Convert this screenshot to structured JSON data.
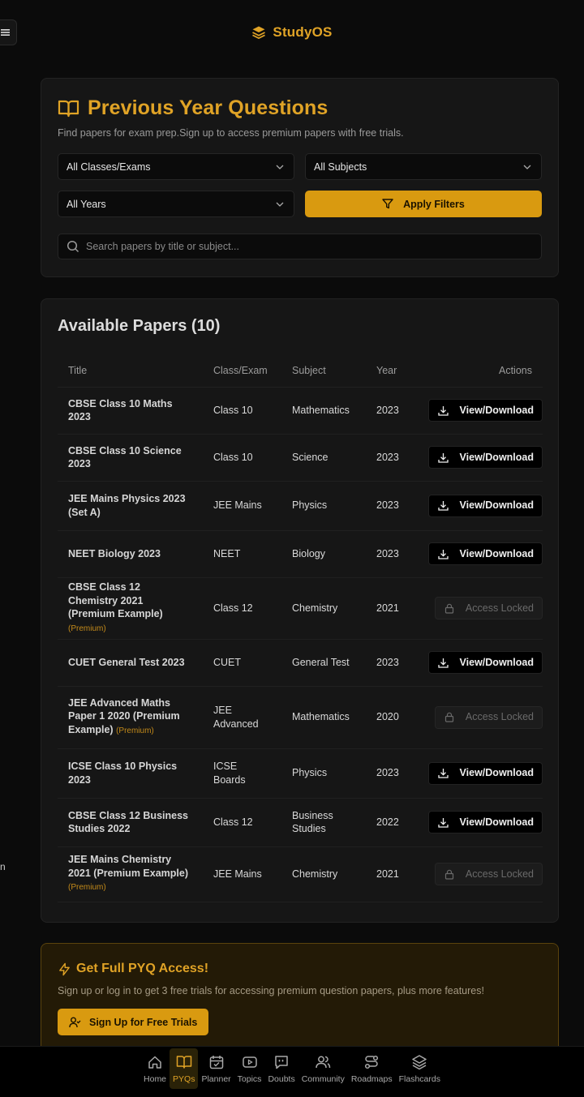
{
  "brand": {
    "name": "StudyOS"
  },
  "header": {
    "title": "Previous Year Questions",
    "subtitle": "Find papers for exam prep.Sign up to access premium papers with free trials."
  },
  "filters": {
    "class_exam": "All Classes/Exams",
    "subjects": "All Subjects",
    "years": "All Years",
    "apply_label": "Apply Filters",
    "search_placeholder": "Search papers by title or subject..."
  },
  "papers": {
    "heading": "Available Papers (10)",
    "columns": [
      "Title",
      "Class/Exam",
      "Subject",
      "Year",
      "Actions"
    ],
    "rows": [
      {
        "title": "CBSE Class 10 Maths 2023",
        "class": "Class 10",
        "subject": "Mathematics",
        "year": "2023",
        "action": "View/Download",
        "locked": false,
        "premium": ""
      },
      {
        "title": "CBSE Class 10 Science 2023",
        "class": "Class 10",
        "subject": "Science",
        "year": "2023",
        "action": "View/Download",
        "locked": false,
        "premium": ""
      },
      {
        "title": "JEE Mains Physics 2023 (Set A)",
        "class": "JEE Mains",
        "subject": "Physics",
        "year": "2023",
        "action": "View/Download",
        "locked": false,
        "premium": ""
      },
      {
        "title": "NEET Biology 2023",
        "class": "NEET",
        "subject": "Biology",
        "year": "2023",
        "action": "View/Download",
        "locked": false,
        "premium": ""
      },
      {
        "title": "CBSE Class 12 Chemistry 2021 (Premium Example)",
        "class": "Class 12",
        "subject": "Chemistry",
        "year": "2021",
        "action": "Access Locked",
        "locked": true,
        "premium": "(Premium)"
      },
      {
        "title": "CUET General Test 2023",
        "class": "CUET",
        "subject": "General Test",
        "year": "2023",
        "action": "View/Download",
        "locked": false,
        "premium": ""
      },
      {
        "title": "JEE Advanced Maths Paper 1 2020 (Premium Example)",
        "class": "JEE Advanced",
        "subject": "Mathematics",
        "year": "2020",
        "action": "Access Locked",
        "locked": true,
        "premium": "(Premium)"
      },
      {
        "title": "ICSE Class 10 Physics 2023",
        "class": "ICSE Boards",
        "subject": "Physics",
        "year": "2023",
        "action": "View/Download",
        "locked": false,
        "premium": ""
      },
      {
        "title": "CBSE Class 12 Business Studies 2022",
        "class": "Class 12",
        "subject": "Business Studies",
        "year": "2022",
        "action": "View/Download",
        "locked": false,
        "premium": ""
      },
      {
        "title": "JEE Mains Chemistry 2021 (Premium Example)",
        "class": "JEE Mains",
        "subject": "Chemistry",
        "year": "2021",
        "action": "Access Locked",
        "locked": true,
        "premium": "(Premium)"
      }
    ]
  },
  "promo": {
    "title": "Get Full PYQ Access!",
    "text": "Sign up or log in to get 3 free trials for accessing premium question papers, plus more features!",
    "button": "Sign Up for Free Trials"
  },
  "side_fragment": "n",
  "nav": {
    "items": [
      {
        "label": "Home",
        "icon": "home-icon",
        "active": false
      },
      {
        "label": "PYQs",
        "icon": "book-icon",
        "active": true
      },
      {
        "label": "Planner",
        "icon": "calendar-check-icon",
        "active": false
      },
      {
        "label": "Topics",
        "icon": "video-icon",
        "active": false
      },
      {
        "label": "Doubts",
        "icon": "message-quote-icon",
        "active": false
      },
      {
        "label": "Community",
        "icon": "users-icon",
        "active": false
      },
      {
        "label": "Roadmaps",
        "icon": "route-icon",
        "active": false
      },
      {
        "label": "Flashcards",
        "icon": "layers-icon",
        "active": false
      }
    ]
  },
  "colors": {
    "accent": "#e0a326",
    "button": "#d99a10",
    "background": "#0b0b0b",
    "card": "#161616"
  }
}
